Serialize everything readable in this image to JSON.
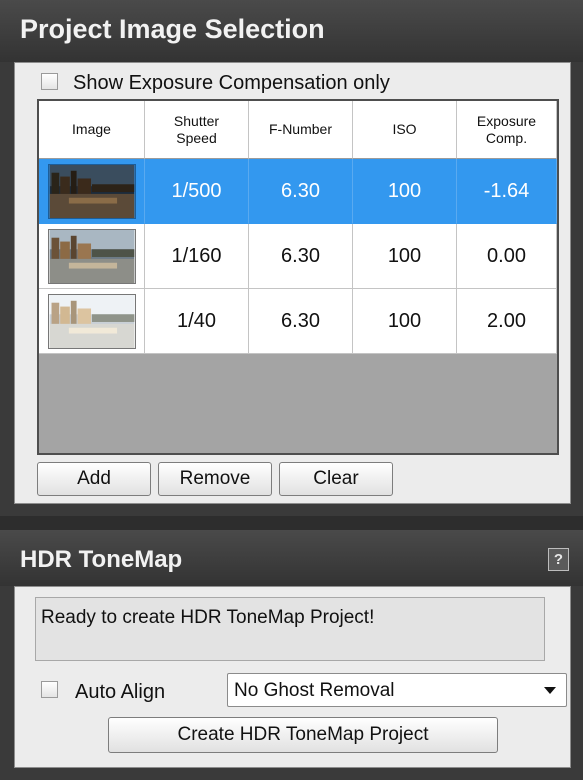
{
  "project_image_selection": {
    "title": "Project Image Selection",
    "exposure_only_label": "Show Exposure Compensation only",
    "columns": [
      "Image",
      "Shutter\nSpeed",
      "F-Number",
      "ISO",
      "Exposure\nComp."
    ],
    "rows": [
      {
        "thumbnail": "city-river-dark-thumbnail",
        "shutter": "1/500",
        "fnumber": "6.30",
        "iso": "100",
        "ev": "-1.64",
        "selected": true
      },
      {
        "thumbnail": "city-river-mid-thumbnail",
        "shutter": "1/160",
        "fnumber": "6.30",
        "iso": "100",
        "ev": "0.00",
        "selected": false
      },
      {
        "thumbnail": "city-river-bright-thumbnail",
        "shutter": "1/40",
        "fnumber": "6.30",
        "iso": "100",
        "ev": "2.00",
        "selected": false
      }
    ],
    "buttons": {
      "add": "Add",
      "remove": "Remove",
      "clear": "Clear"
    }
  },
  "hdr_tonemap": {
    "title": "HDR ToneMap",
    "help_glyph": "?",
    "status": "Ready to create HDR ToneMap Project!",
    "auto_align_label": "Auto Align",
    "ghost_removal_selected": "No Ghost Removal",
    "create_button": "Create HDR ToneMap Project"
  },
  "colors": {
    "selection": "#3398ef",
    "header": "#3a3a3a",
    "panel": "#ececec"
  }
}
